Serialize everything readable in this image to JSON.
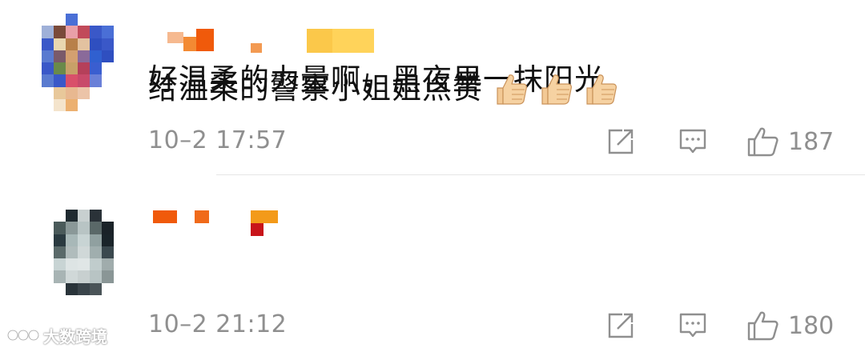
{
  "comments": [
    {
      "text": "好温柔的力量啊，黑夜里一抹阳光",
      "timestamp": "10–2 17:57",
      "likes": "187",
      "username_blocks": [
        {
          "color": "#f6b98f"
        },
        {
          "color": "#f38a33"
        },
        {
          "color": "#f05a0b"
        },
        {
          "color": "#f39a52"
        },
        {
          "color": "#fbc84a"
        },
        {
          "color": "#ffd35a"
        }
      ],
      "avatar_colors": [
        "#ffffff",
        "#ffffff",
        "#4a6fd6",
        "#ffffff",
        "#ffffff",
        "#ffffff",
        "#ffffff",
        "#9fb0d8",
        "#7a4a3a",
        "#e9a0a8",
        "#c14a5a",
        "#3a58c8",
        "#4a6fd6",
        "#ffffff",
        "#3a58c8",
        "#e9d7b0",
        "#b8804a",
        "#e3c2a0",
        "#2f4fc0",
        "#3a58c8",
        "#ffffff",
        "#5a7bd0",
        "#7a5a6a",
        "#d4a070",
        "#8a6a9a",
        "#3060d0",
        "#2f4fc0",
        "#ffffff",
        "#3a58c8",
        "#6a8a4a",
        "#c8a068",
        "#b5405a",
        "#3a5ed0",
        "#ffffff",
        "#ffffff",
        "#5a7bd0",
        "#3a58c8",
        "#d9506a",
        "#c84a6a",
        "#6a80d8",
        "#ffffff",
        "#ffffff",
        "#ffffff",
        "#e8c89a",
        "#e8b890",
        "#ecc4a8",
        "#ffffff",
        "#ffffff",
        "#ffffff",
        "#ffffff",
        "#f4e4cc",
        "#ecb070",
        "#ffffff",
        "#ffffff",
        "#ffffff",
        "#ffffff"
      ]
    },
    {
      "text": "给温柔的警察小姐姐点赞",
      "timestamp": "10–2 21:12",
      "likes": "180",
      "username_blocks": [
        {
          "color": "#f05a0b"
        },
        {
          "color": "#f06a1a"
        },
        {
          "color": "#f39a1a"
        },
        {
          "color": "#c8141a"
        }
      ],
      "avatar_colors": [
        "#ffffff",
        "#ffffff",
        "#1f2a30",
        "#c8d0d0",
        "#2a3238",
        "#ffffff",
        "#ffffff",
        "#ffffff",
        "#4a5a5a",
        "#8a9898",
        "#b8c4c4",
        "#5a6868",
        "#1a2228",
        "#ffffff",
        "#ffffff",
        "#2a3a40",
        "#a8b8b8",
        "#c8d4d4",
        "#90a0a0",
        "#1a242a",
        "#ffffff",
        "#ffffff",
        "#5a6a6a",
        "#b0bcbc",
        "#d0d8d8",
        "#a0aeae",
        "#3a484e",
        "#ffffff",
        "#ffffff",
        "#c8d4d4",
        "#dde4e4",
        "#e0e6e6",
        "#c0cccc",
        "#a0acac",
        "#ffffff",
        "#ffffff",
        "#a8b4b4",
        "#d0d8d8",
        "#c8d0d0",
        "#b8c4c4",
        "#8a9696",
        "#ffffff",
        "#ffffff",
        "#ffffff",
        "#2a343a",
        "#3a444a",
        "#4a5458",
        "#ffffff",
        "#ffffff",
        "#ffffff",
        "#ffffff",
        "#ffffff",
        "#ffffff",
        "#ffffff",
        "#ffffff",
        "#ffffff"
      ],
      "emoji": [
        "thumbs-up-emoji",
        "thumbs-up-emoji",
        "thumbs-up-emoji"
      ]
    }
  ],
  "watermark": {
    "text": "大数跨境"
  },
  "icons": {
    "share": "share-icon",
    "reply": "comment-icon",
    "like": "thumbs-up-icon"
  },
  "colors": {
    "text": "#111111",
    "meta": "#8f8f8f",
    "divider": "#e6e6e6"
  }
}
